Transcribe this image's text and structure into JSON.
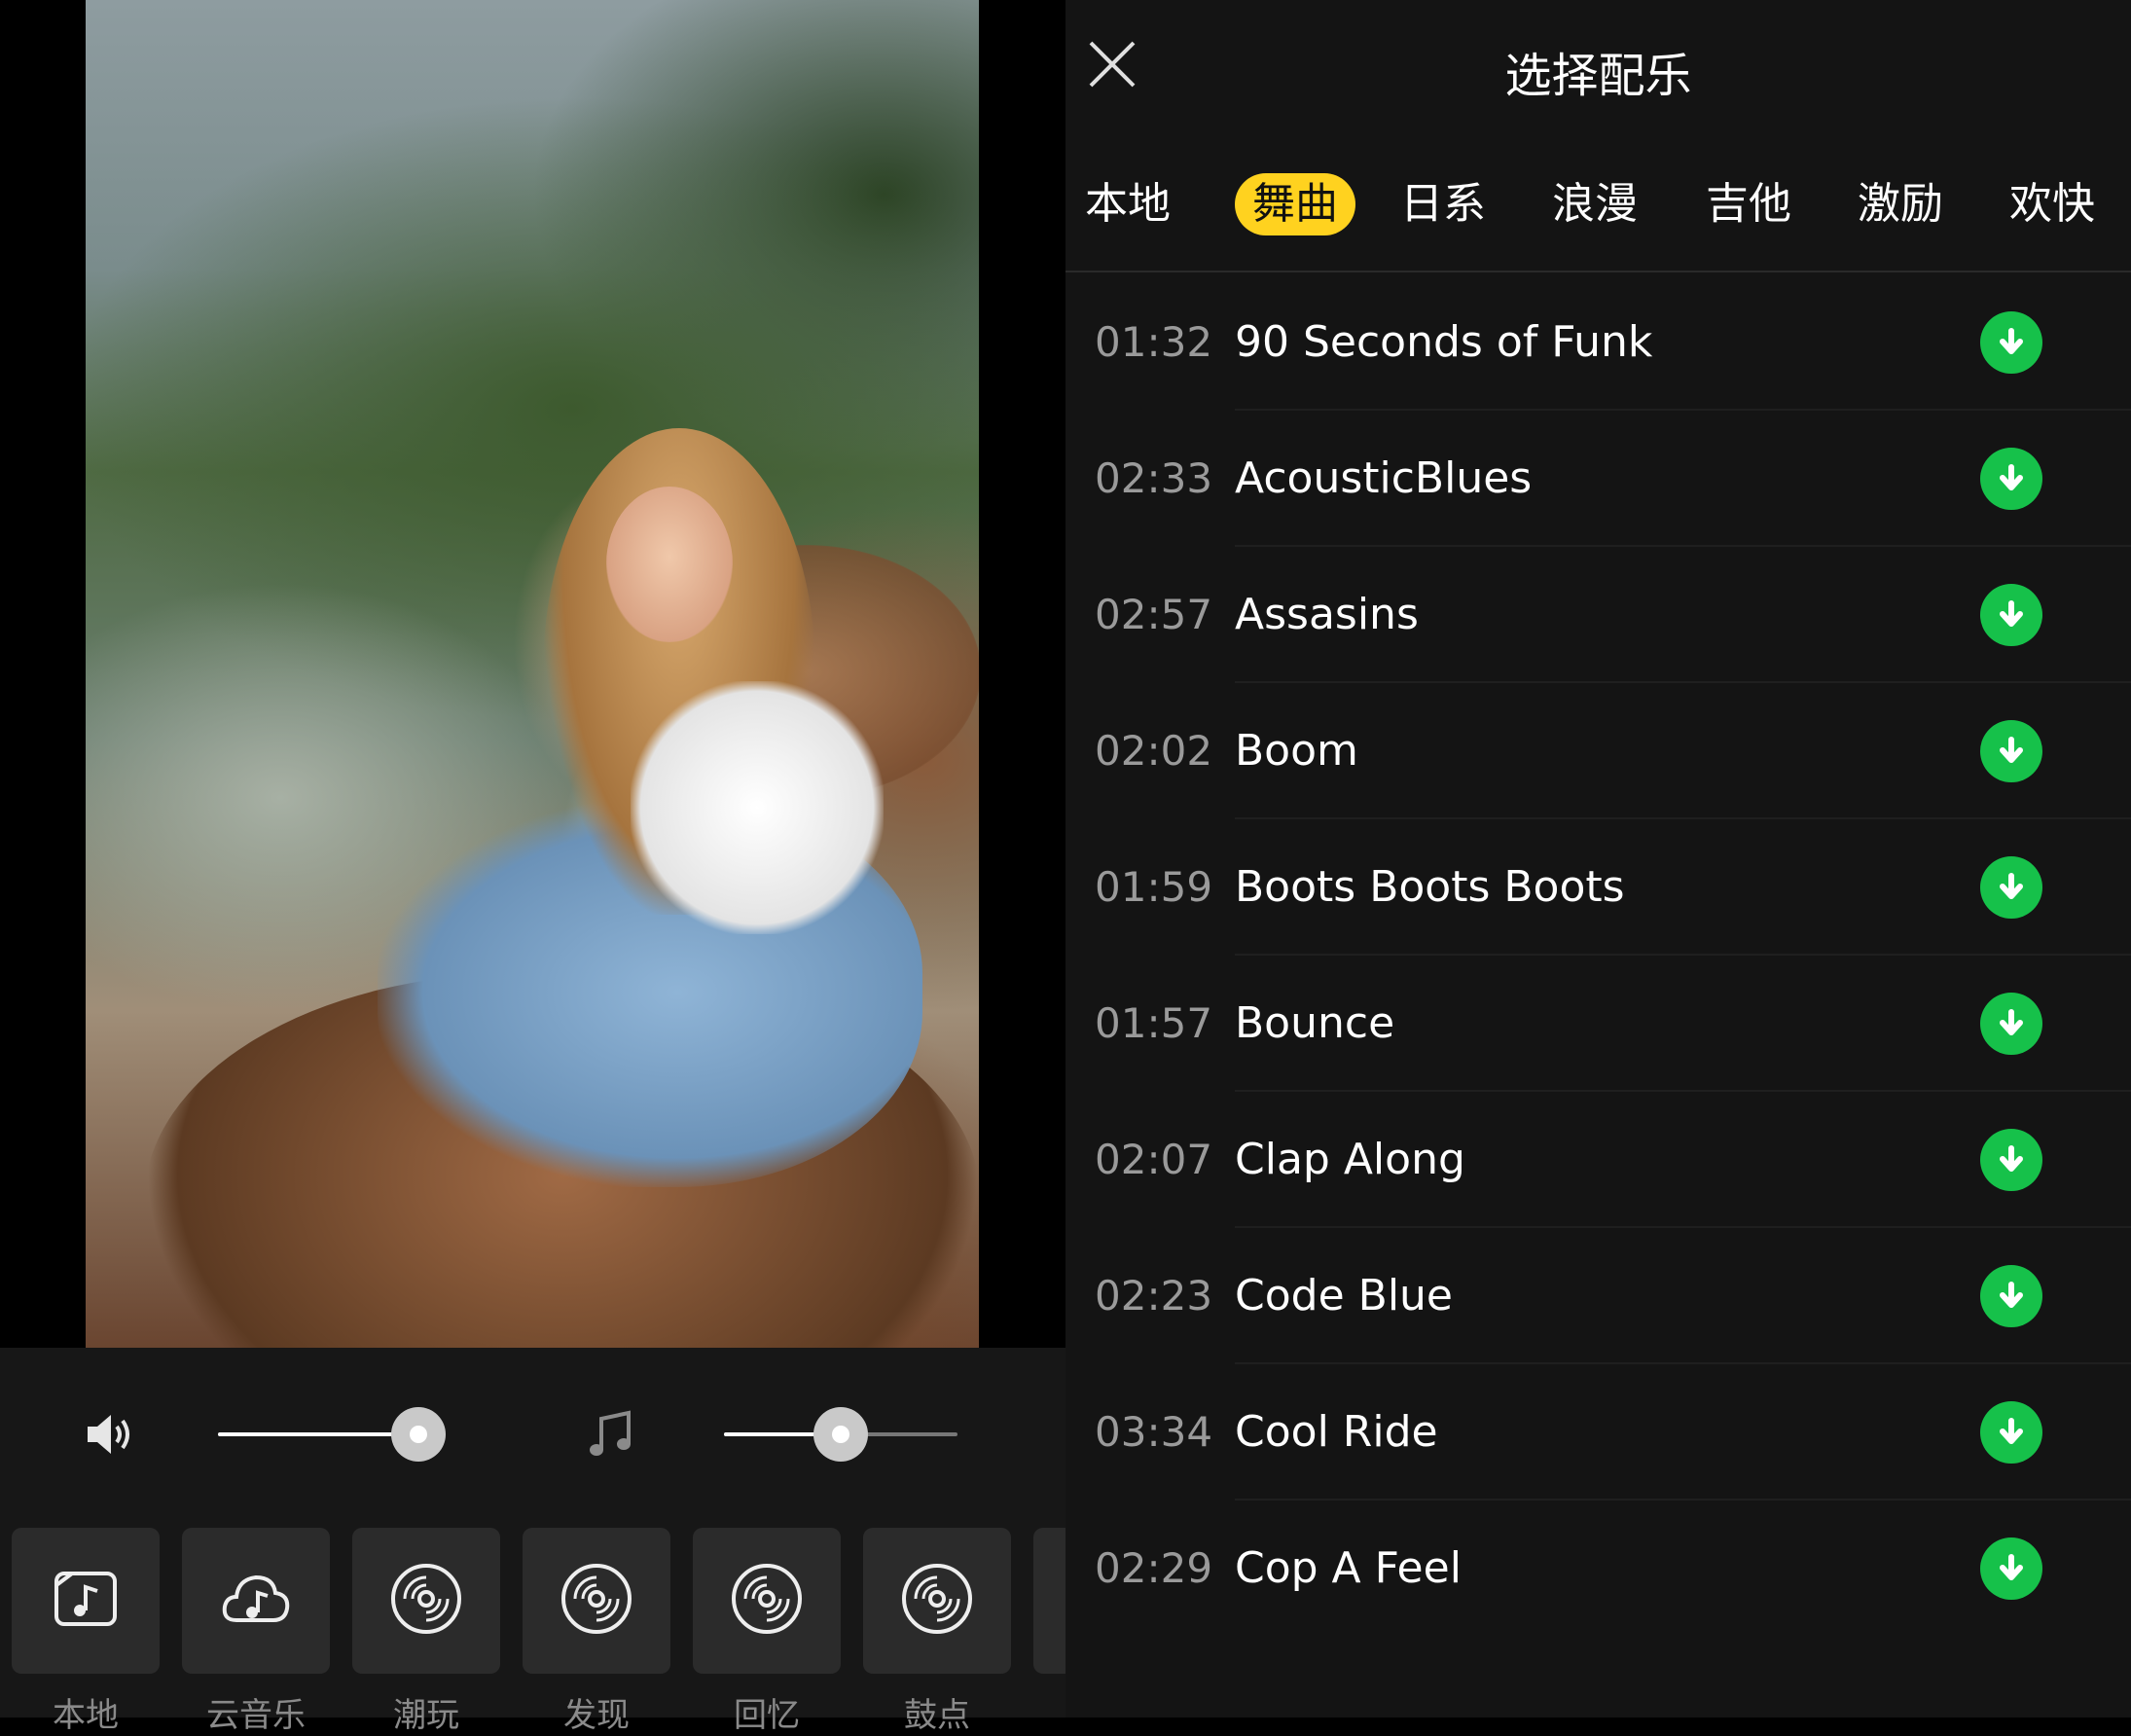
{
  "header": {
    "title": "选择配乐",
    "close_icon": "close-icon"
  },
  "tabs": [
    {
      "label": "本地",
      "active": false
    },
    {
      "label": "舞曲",
      "active": true
    },
    {
      "label": "日系",
      "active": false
    },
    {
      "label": "浪漫",
      "active": false
    },
    {
      "label": "吉他",
      "active": false
    },
    {
      "label": "激励",
      "active": false
    },
    {
      "label": "欢快",
      "active": false
    }
  ],
  "tracks": [
    {
      "duration": "01:32",
      "name": "90 Seconds of Funk"
    },
    {
      "duration": "02:33",
      "name": "AcousticBlues"
    },
    {
      "duration": "02:57",
      "name": "Assasins"
    },
    {
      "duration": "02:02",
      "name": "Boom"
    },
    {
      "duration": "01:59",
      "name": "Boots Boots Boots"
    },
    {
      "duration": "01:57",
      "name": "Bounce"
    },
    {
      "duration": "02:07",
      "name": "Clap Along"
    },
    {
      "duration": "02:23",
      "name": "Code Blue"
    },
    {
      "duration": "03:34",
      "name": "Cool Ride"
    },
    {
      "duration": "02:29",
      "name": "Cop A Feel"
    }
  ],
  "volume": {
    "original_level": 0.88,
    "music_level": 0.5
  },
  "categories": [
    {
      "label": "本地",
      "icon": "music-file-icon"
    },
    {
      "label": "云音乐",
      "icon": "cloud-music-icon"
    },
    {
      "label": "潮玩",
      "icon": "vinyl-disc-icon"
    },
    {
      "label": "发现",
      "icon": "vinyl-disc-icon"
    },
    {
      "label": "回忆",
      "icon": "vinyl-disc-icon"
    },
    {
      "label": "鼓点",
      "icon": "vinyl-disc-icon"
    }
  ],
  "colors": {
    "accent": "#ffd21f",
    "download": "#16c14a",
    "panel": "#141414"
  }
}
